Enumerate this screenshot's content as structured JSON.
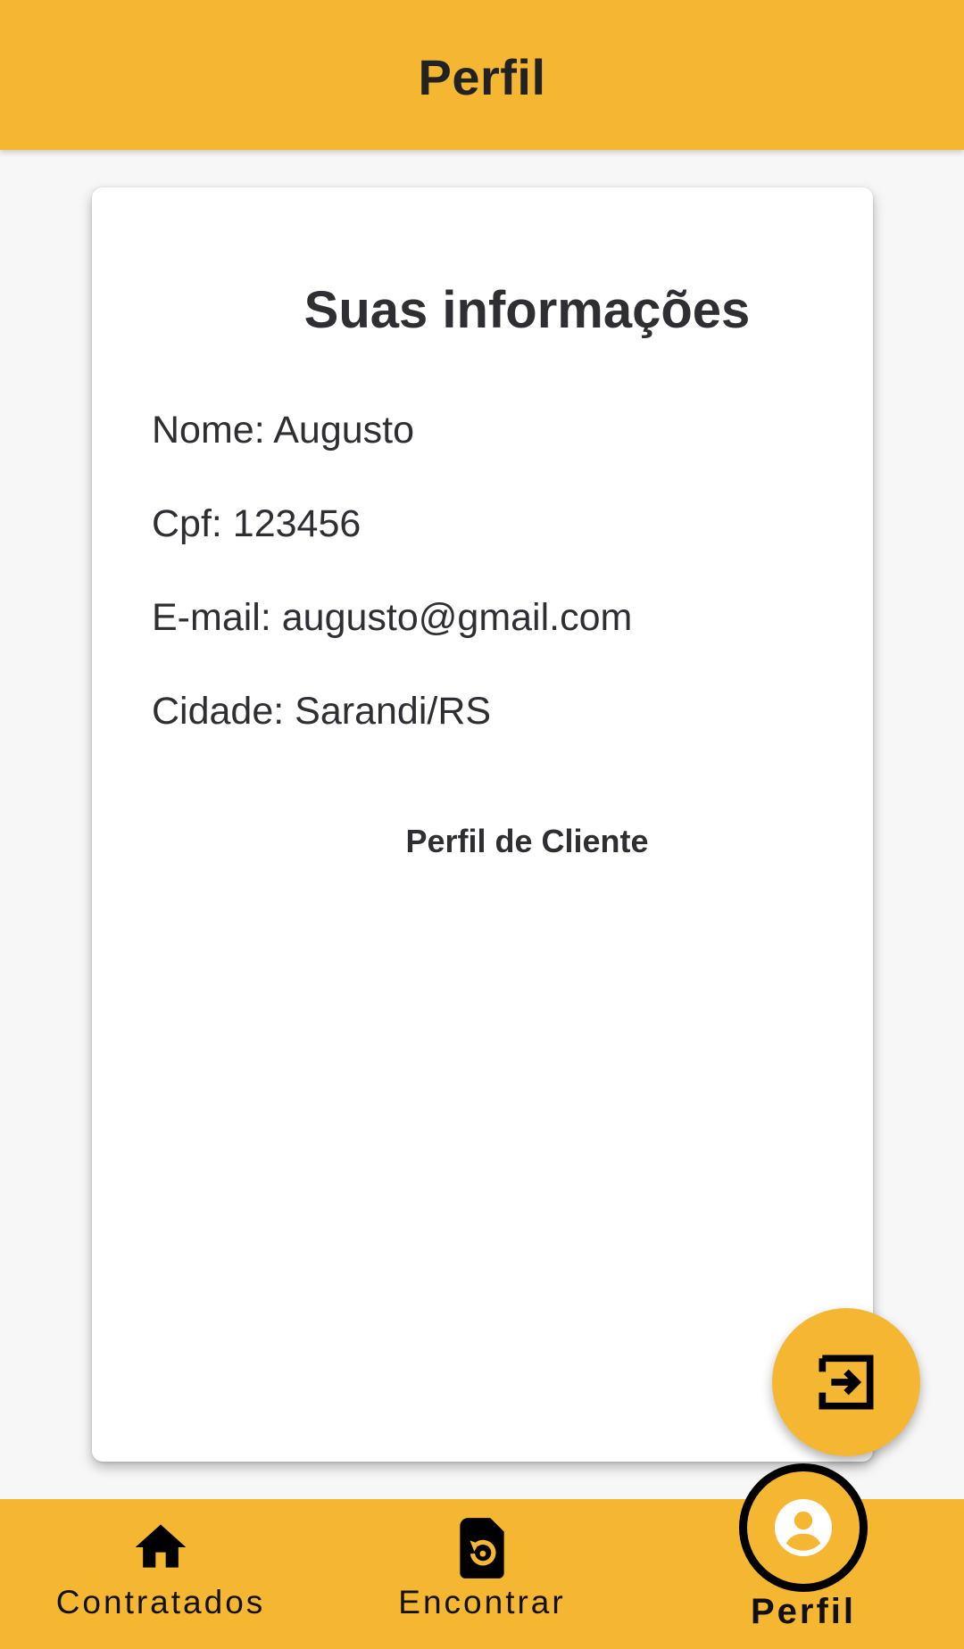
{
  "appbar": {
    "title": "Perfil"
  },
  "card": {
    "title": "Suas informações",
    "lines": [
      "Nome: Augusto",
      "Cpf: 123456",
      "E-mail: augusto@gmail.com",
      "Cidade: Sarandi/RS"
    ],
    "profile_type": "Perfil de Cliente"
  },
  "fab": {
    "icon": "logout-icon"
  },
  "bottom_nav": {
    "items": [
      {
        "label": "Contratados",
        "icon": "home-icon"
      },
      {
        "label": "Encontrar",
        "icon": "find-document-icon"
      },
      {
        "label": "Perfil",
        "icon": "account-circle-icon",
        "active": true
      }
    ]
  },
  "colors": {
    "accent": "#f5b632",
    "text": "#2e2e33"
  }
}
